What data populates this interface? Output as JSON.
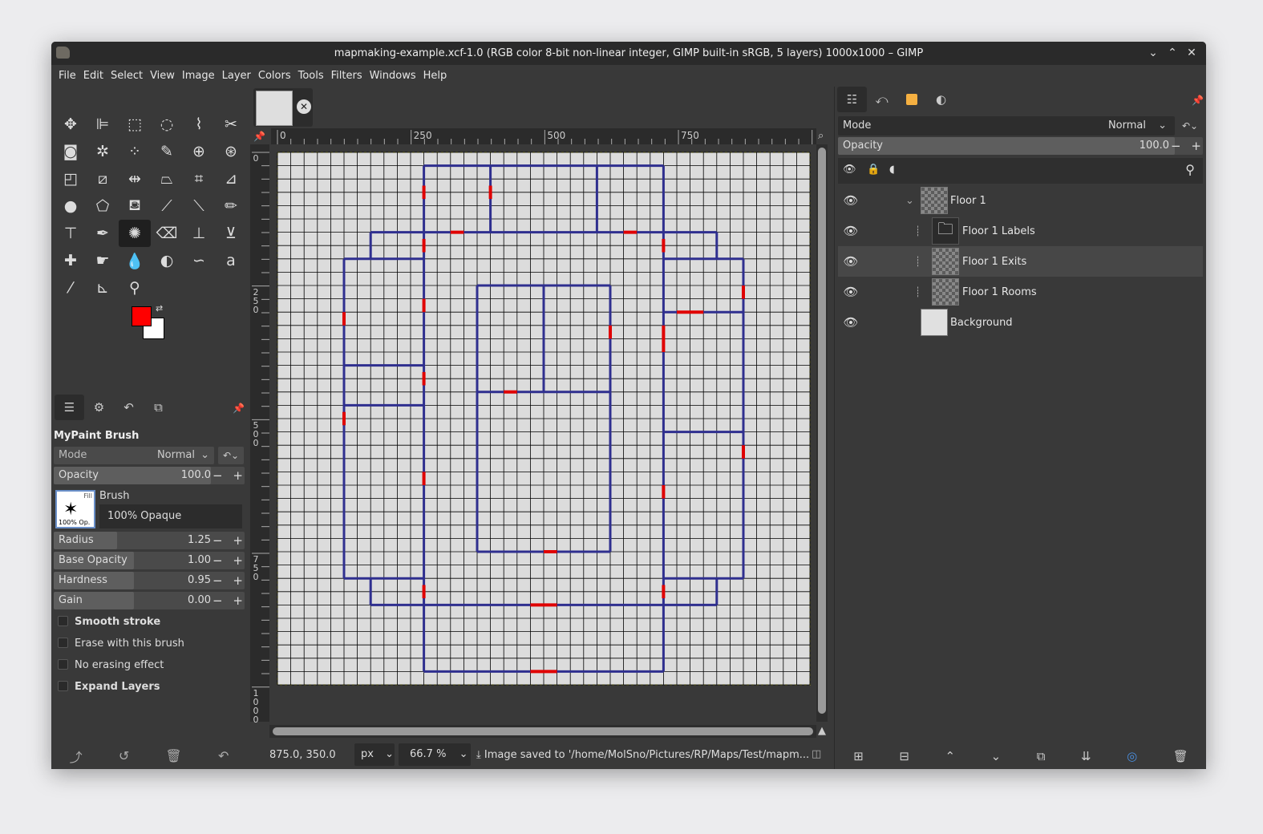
{
  "window": {
    "title": "mapmaking-example.xcf-1.0 (RGB color 8-bit non-linear integer, GIMP built-in sRGB, 5 layers) 1000x1000 – GIMP",
    "controls": [
      "⌄",
      "⌃",
      "✕"
    ]
  },
  "menu": [
    "File",
    "Edit",
    "Select",
    "View",
    "Image",
    "Layer",
    "Colors",
    "Tools",
    "Filters",
    "Windows",
    "Help"
  ],
  "toolbox": {
    "tools": [
      {
        "name": "move-tool",
        "glyph": "✥"
      },
      {
        "name": "align-tool",
        "glyph": "⊫"
      },
      {
        "name": "rect-select-tool",
        "glyph": "⬚"
      },
      {
        "name": "ellipse-select-tool",
        "glyph": "◌"
      },
      {
        "name": "free-select-tool",
        "glyph": "⌇"
      },
      {
        "name": "scissors-tool",
        "glyph": "✂"
      },
      {
        "name": "foreground-select-tool",
        "glyph": "◙"
      },
      {
        "name": "fuzzy-select-tool",
        "glyph": "✲"
      },
      {
        "name": "color-select-tool",
        "glyph": "⁘"
      },
      {
        "name": "paths-tool",
        "glyph": "✎"
      },
      {
        "name": "transform-tool",
        "glyph": "⊕"
      },
      {
        "name": "warp-tool",
        "glyph": "⊛"
      },
      {
        "name": "crop-tool",
        "glyph": "◰"
      },
      {
        "name": "shear-tool",
        "glyph": "⧄"
      },
      {
        "name": "flip-tool",
        "glyph": "⇹"
      },
      {
        "name": "perspective-tool",
        "glyph": "⏢"
      },
      {
        "name": "3d-transform-tool",
        "glyph": "⌗"
      },
      {
        "name": "measure-angle-tool",
        "glyph": "⊿"
      },
      {
        "name": "bucket-tool",
        "glyph": "●"
      },
      {
        "name": "cage-tool",
        "glyph": "⬠"
      },
      {
        "name": "fill-tool",
        "glyph": "⛾"
      },
      {
        "name": "gradient-tool",
        "glyph": "⟋"
      },
      {
        "name": "paintbrush-tool",
        "glyph": "⟍"
      },
      {
        "name": "pencil-tool",
        "glyph": "✏"
      },
      {
        "name": "airbrush-tool",
        "glyph": "⊤"
      },
      {
        "name": "ink-tool",
        "glyph": "✒"
      },
      {
        "name": "mypaint-brush-tool",
        "glyph": "✺"
      },
      {
        "name": "eraser-tool",
        "glyph": "⌫"
      },
      {
        "name": "clone-tool",
        "glyph": "⊥"
      },
      {
        "name": "heal-tool",
        "glyph": "⊻"
      },
      {
        "name": "bandage-tool",
        "glyph": "✚"
      },
      {
        "name": "smudge-tool",
        "glyph": "☛"
      },
      {
        "name": "blur-tool",
        "glyph": "💧"
      },
      {
        "name": "dodge-burn-tool",
        "glyph": "◐"
      },
      {
        "name": "path-tool",
        "glyph": "∽"
      },
      {
        "name": "text-tool",
        "glyph": "a"
      },
      {
        "name": "color-picker-tool",
        "glyph": "⁄"
      },
      {
        "name": "measure-tool",
        "glyph": "⊾"
      },
      {
        "name": "zoom-tool",
        "glyph": "⚲"
      }
    ],
    "selected_tool": "mypaint-brush-tool",
    "foreground_color": "#ff0000",
    "background_color": "#ffffff"
  },
  "tool_options": {
    "title": "MyPaint Brush",
    "mode_label": "Mode",
    "mode_value": "Normal",
    "opacity_label": "Opacity",
    "opacity_value": "100.0",
    "brush_label": "Brush",
    "brush_name": "100% Opaque",
    "brush_thumb_text": "100% Op.",
    "brush_thumb_corner": "Fill",
    "radius_label": "Radius",
    "radius_value": "1.25",
    "radius_fraction": 0.33,
    "base_opacity_label": "Base Opacity",
    "base_opacity_value": "1.00",
    "base_opacity_fraction": 0.42,
    "hardness_label": "Hardness",
    "hardness_value": "0.95",
    "hardness_fraction": 0.42,
    "gain_label": "Gain",
    "gain_value": "0.00",
    "gain_fraction": 0.42,
    "checks": [
      {
        "label": "Smooth stroke",
        "bold": true
      },
      {
        "label": "Erase with this brush",
        "bold": false
      },
      {
        "label": "No erasing effect",
        "bold": false
      },
      {
        "label": "Expand Layers",
        "bold": true
      }
    ]
  },
  "canvas": {
    "hruler_labels": [
      "0",
      "250",
      "500",
      "750"
    ],
    "vruler_labels": [
      "0",
      "250",
      "500",
      "750",
      "1000"
    ],
    "wall_color": "#2f2f8f",
    "door_color": "#e00000",
    "grid_color": "#000000",
    "paper_color": "#dcdcdc"
  },
  "status": {
    "coords": "875.0, 350.0",
    "unit": "px",
    "zoom": "66.7 %",
    "message": "Image saved to '/home/MolSno/Pictures/RP/Maps/Test/mapm..."
  },
  "layers_panel": {
    "mode_label": "Mode",
    "mode_value": "Normal",
    "opacity_label": "Opacity",
    "opacity_value": "100.0",
    "layers": [
      {
        "name": "Floor 1",
        "indent": 0,
        "type": "group-expanded",
        "selected": false
      },
      {
        "name": "Floor 1 Labels",
        "indent": 1,
        "type": "folder",
        "selected": false
      },
      {
        "name": "Floor 1 Exits",
        "indent": 1,
        "type": "transparent",
        "selected": true
      },
      {
        "name": "Floor 1 Rooms",
        "indent": 1,
        "type": "transparent",
        "selected": false
      },
      {
        "name": "Background",
        "indent": 0,
        "type": "white",
        "selected": false
      }
    ]
  }
}
